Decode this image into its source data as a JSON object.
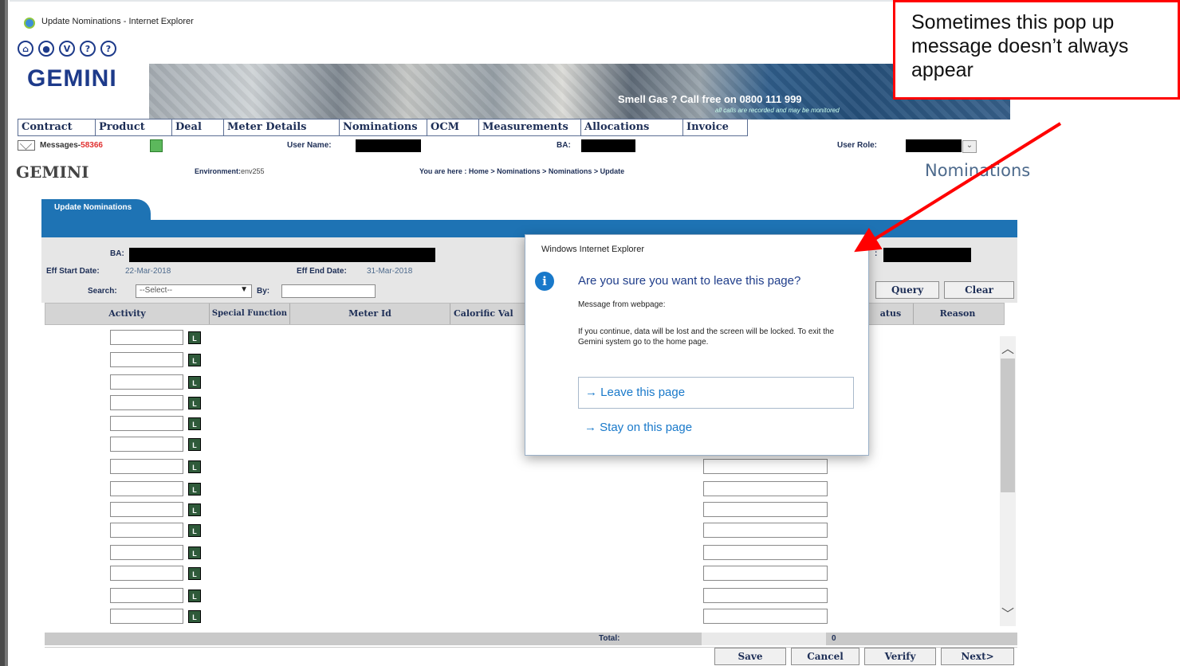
{
  "window": {
    "title": "Update Nominations - Internet Explorer"
  },
  "app": {
    "logo": "GEMINI",
    "icons": [
      "home-icon",
      "star-icon",
      "v-icon",
      "help-icon",
      "help-icon"
    ],
    "icon_glyphs": [
      "⌂",
      "●",
      "V",
      "?",
      "?"
    ],
    "banner_smell_gas_prefix": "Smell Gas ? Call free on",
    "banner_phone": "0800 111 999",
    "banner_recorded": "all calls are recorded and may be monitored"
  },
  "menu": [
    "Contract",
    "Product",
    "Deal",
    "Meter Details",
    "Nominations",
    "OCM",
    "Measurements",
    "Allocations",
    "Invoice"
  ],
  "messages": {
    "label": "Messages-",
    "count": "58366"
  },
  "user": {
    "name_label": "User Name:",
    "ba_label": "BA:",
    "role_label": "User Role:"
  },
  "env": {
    "logo": "GEMINI",
    "env_label": "Environment:",
    "env_value": "env255",
    "breadcrumb": "You are here : Home > Nominations > Nominations > Update",
    "page_title": "Nominations"
  },
  "form": {
    "tab": "Update Nominations",
    "ba_label": "BA:",
    "eff_start_label": "Eff Start Date:",
    "eff_start_value": "22-Mar-2018",
    "eff_end_label": "Eff End Date:",
    "eff_end_value": "31-Mar-2018",
    "search_label": "Search:",
    "search_value": "--Select--",
    "by_label": "By:",
    "right_label": ":",
    "query_btn": "Query",
    "clear_btn": "Clear"
  },
  "columns": [
    "Activity",
    "Special Function",
    "Meter Id",
    "Calorific Val",
    "atus",
    "Reason"
  ],
  "row_button": "L",
  "total": {
    "label": "Total:",
    "value": "0"
  },
  "actions": {
    "save": "Save",
    "cancel": "Cancel",
    "verify": "Verify",
    "next": "Next>"
  },
  "dialog": {
    "title": "Windows Internet Explorer",
    "question": "Are you sure you want to leave this page?",
    "from": "Message from webpage:",
    "message": "If you continue, data will be lost and the screen will be locked. To exit the Gemini system go to the home page.",
    "leave": "Leave this page",
    "stay": "Stay on this page",
    "arrow": "→"
  },
  "annotation": {
    "text": "Sometimes this pop up message doesn’t always appear",
    "color": "#ff0000"
  },
  "colors": {
    "brand_blue": "#1e73b4",
    "navy": "#1d2e56",
    "dialog_blue": "#1979ca"
  }
}
